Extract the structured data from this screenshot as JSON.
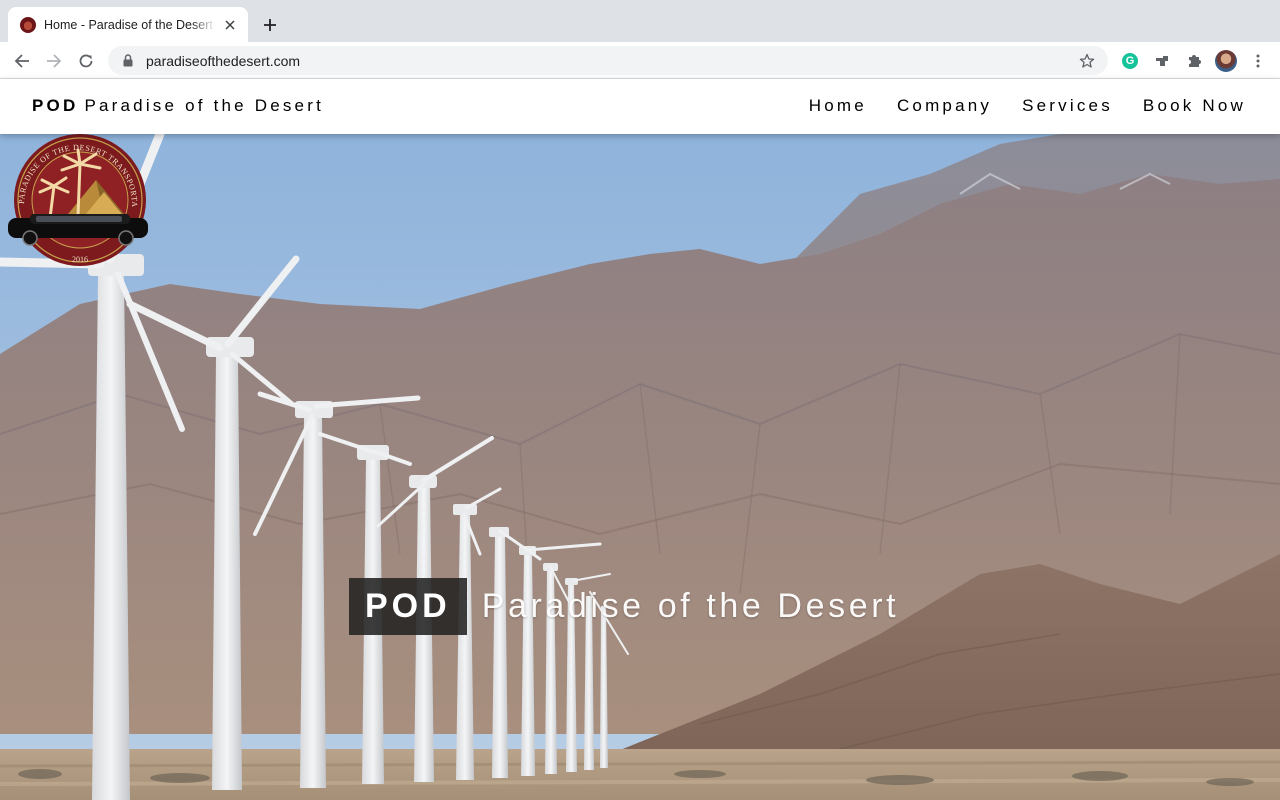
{
  "browser": {
    "tab_title": "Home - Paradise of the Desert",
    "url": "paradiseofthedesert.com",
    "icons": {
      "back": "back-arrow-icon",
      "forward": "forward-arrow-icon",
      "reload": "reload-icon",
      "lock": "lock-icon",
      "bookmark": "star-icon",
      "extensions": [
        "grammarly-icon",
        "cast-icon",
        "puzzle-icon"
      ],
      "profile": "avatar",
      "menu": "kebab-menu-icon"
    },
    "grammarly_letter": "G"
  },
  "header": {
    "brand_strong": "POD",
    "brand_name": "Paradise of the Desert",
    "nav": [
      {
        "label": "Home"
      },
      {
        "label": "Company"
      },
      {
        "label": "Services"
      },
      {
        "label": "Book Now"
      }
    ]
  },
  "hero": {
    "title_strong": "POD",
    "title_name": "Paradise of the Desert",
    "background": "wind-turbines-desert-mountains-photo",
    "emblem": {
      "ring_text": "PARADISE OF THE DESERT TRANSPORTATION SERVICES",
      "year": "2016"
    }
  },
  "colors": {
    "tabstrip": "#dee1e6",
    "header_bg": "#ffffff",
    "pod_box": "#222222",
    "emblem_red": "#8a1c20"
  }
}
